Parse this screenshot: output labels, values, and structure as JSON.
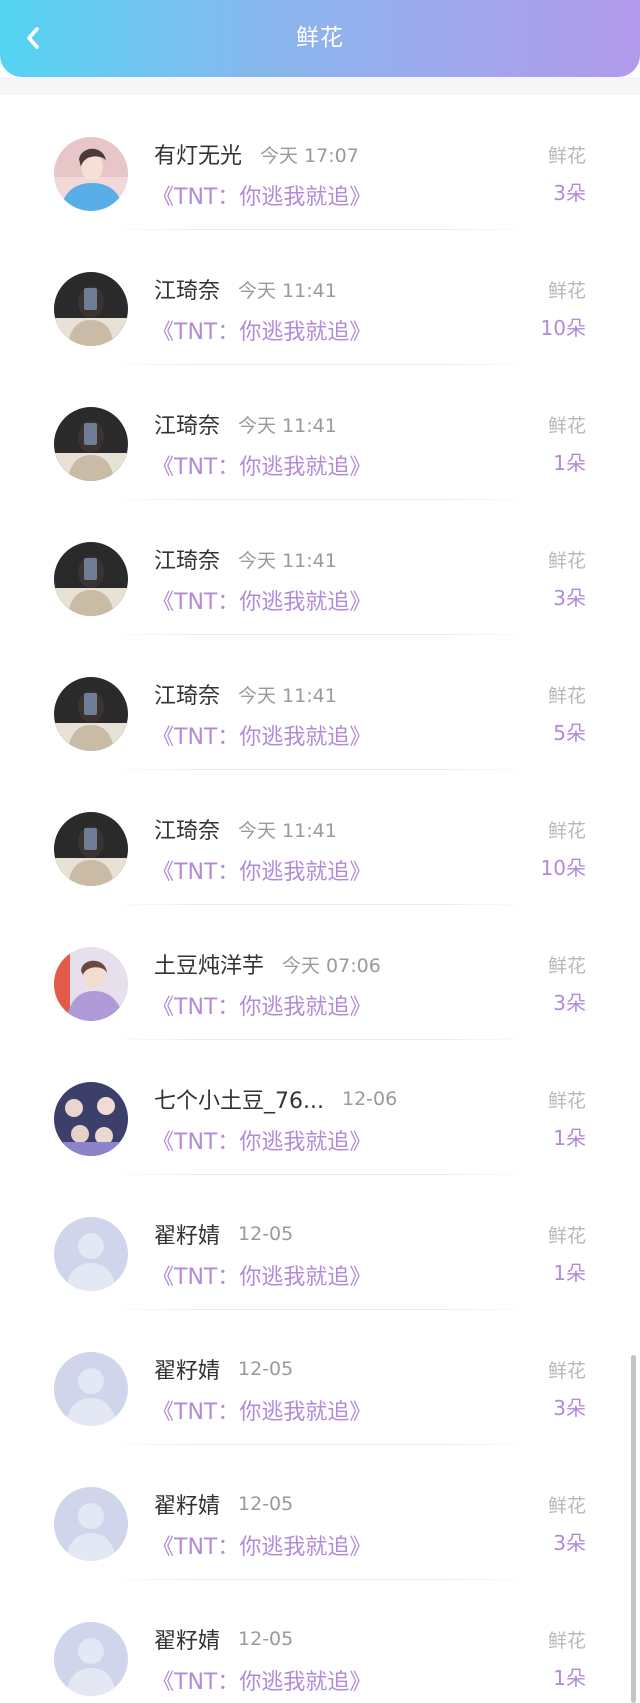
{
  "header": {
    "title": "鲜花",
    "back_icon": "chevron-left-icon",
    "gradient": [
      "#54d4f2",
      "#b39aec"
    ]
  },
  "colors": {
    "accent_purple": "#b28ad8",
    "name_text": "#333333",
    "time_text": "#9a9a9a",
    "label_text": "#b8b8b8"
  },
  "records": [
    {
      "name": "有灯无光",
      "time": "今天 17:07",
      "book": "《TNT：你逃我就追》",
      "label": "鲜花",
      "count": "3朵",
      "avatar": "photo-avatar-girl-blue"
    },
    {
      "name": "江琦奈",
      "time": "今天 11:41",
      "book": "《TNT：你逃我就追》",
      "label": "鲜花",
      "count": "10朵",
      "avatar": "photo-avatar-mirror"
    },
    {
      "name": "江琦奈",
      "time": "今天 11:41",
      "book": "《TNT：你逃我就追》",
      "label": "鲜花",
      "count": "1朵",
      "avatar": "photo-avatar-mirror"
    },
    {
      "name": "江琦奈",
      "time": "今天 11:41",
      "book": "《TNT：你逃我就追》",
      "label": "鲜花",
      "count": "3朵",
      "avatar": "photo-avatar-mirror"
    },
    {
      "name": "江琦奈",
      "time": "今天 11:41",
      "book": "《TNT：你逃我就追》",
      "label": "鲜花",
      "count": "5朵",
      "avatar": "photo-avatar-mirror"
    },
    {
      "name": "江琦奈",
      "time": "今天 11:41",
      "book": "《TNT：你逃我就追》",
      "label": "鲜花",
      "count": "10朵",
      "avatar": "photo-avatar-mirror"
    },
    {
      "name": "土豆炖洋芋",
      "time": "今天 07:06",
      "book": "《TNT：你逃我就追》",
      "label": "鲜花",
      "count": "3朵",
      "avatar": "photo-avatar-boy-purple"
    },
    {
      "name": "七个小土豆_76...",
      "time": "12-06",
      "book": "《TNT：你逃我就追》",
      "label": "鲜花",
      "count": "1朵",
      "avatar": "photo-avatar-group"
    },
    {
      "name": "翟籽婧",
      "time": "12-05",
      "book": "《TNT：你逃我就追》",
      "label": "鲜花",
      "count": "1朵",
      "avatar": "default-avatar-icon"
    },
    {
      "name": "翟籽婧",
      "time": "12-05",
      "book": "《TNT：你逃我就追》",
      "label": "鲜花",
      "count": "3朵",
      "avatar": "default-avatar-icon"
    },
    {
      "name": "翟籽婧",
      "time": "12-05",
      "book": "《TNT：你逃我就追》",
      "label": "鲜花",
      "count": "3朵",
      "avatar": "default-avatar-icon"
    },
    {
      "name": "翟籽婧",
      "time": "12-05",
      "book": "《TNT：你逃我就追》",
      "label": "鲜花",
      "count": "1朵",
      "avatar": "default-avatar-icon"
    }
  ]
}
